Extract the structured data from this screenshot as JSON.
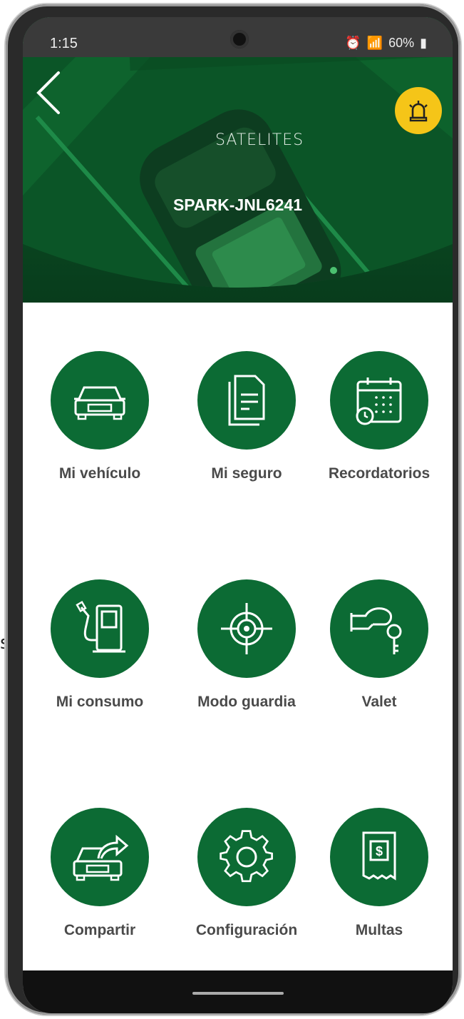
{
  "stray": {
    "text": "s"
  },
  "status": {
    "time": "1:15",
    "battery": "60%"
  },
  "header": {
    "brand": "SATELITES",
    "vehicle": "SPARK-JNL6241"
  },
  "menu": [
    {
      "label": "Mi vehículo",
      "icon": "car-icon"
    },
    {
      "label": "Mi seguro",
      "icon": "document-icon"
    },
    {
      "label": "Recordatorios",
      "icon": "calendar-clock-icon"
    },
    {
      "label": "Mi consumo",
      "icon": "fuel-pump-icon"
    },
    {
      "label": "Modo guardia",
      "icon": "crosshair-icon"
    },
    {
      "label": "Valet",
      "icon": "hand-key-icon"
    },
    {
      "label": "Compartir",
      "icon": "car-share-icon"
    },
    {
      "label": "Configuración",
      "icon": "gear-icon"
    },
    {
      "label": "Multas",
      "icon": "receipt-icon"
    }
  ],
  "colors": {
    "accent": "#0c6b34",
    "bell": "#f5c518"
  }
}
